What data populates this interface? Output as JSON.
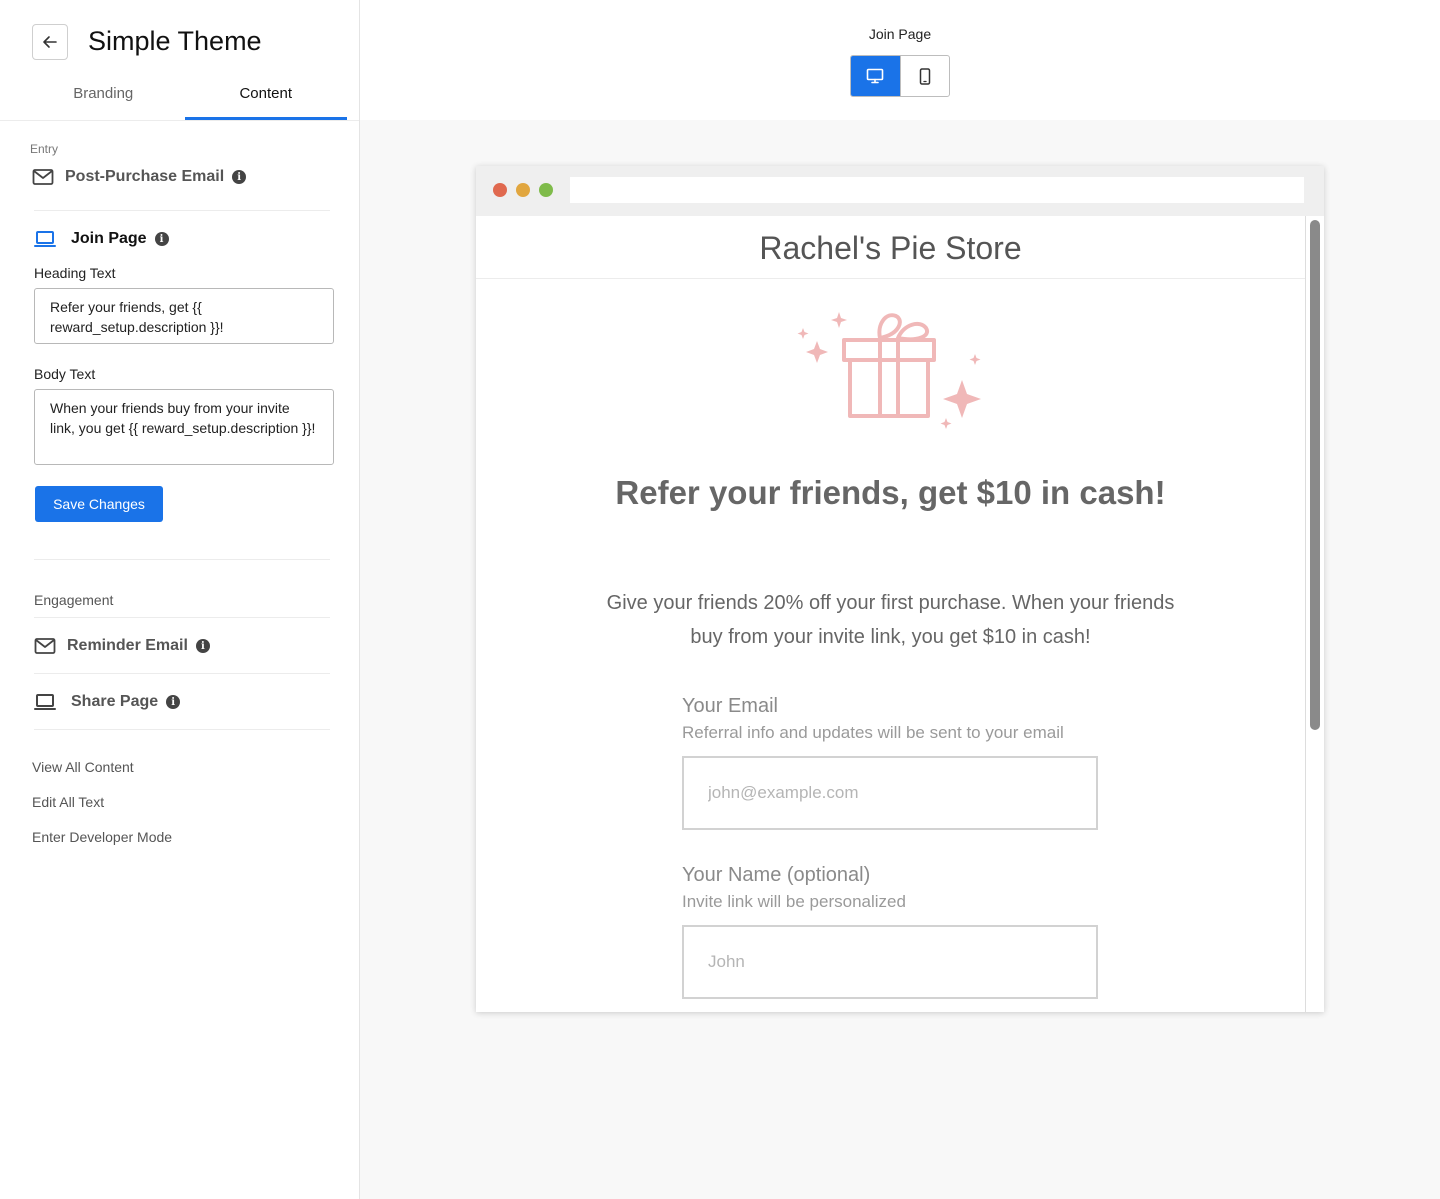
{
  "sidebar": {
    "title": "Simple Theme",
    "tabs": [
      {
        "label": "Branding",
        "active": false
      },
      {
        "label": "Content",
        "active": true
      }
    ],
    "entry_label": "Entry",
    "post_purchase_email": "Post-Purchase Email",
    "join_page": "Join Page",
    "heading_text_label": "Heading Text",
    "heading_text_value": "Refer your friends, get {{ reward_setup.description }}!",
    "body_text_label": "Body Text",
    "body_text_value": "When your friends buy from your invite link, you get {{ reward_setup.description }}!",
    "save_label": "Save Changes",
    "engagement_label": "Engagement",
    "reminder_email": "Reminder Email",
    "share_page": "Share Page",
    "links": [
      "View All Content",
      "Edit All Text",
      "Enter Developer Mode"
    ],
    "info_glyph": "i"
  },
  "header": {
    "page_name": "Join Page",
    "views": [
      {
        "name": "desktop-icon",
        "active": true
      },
      {
        "name": "mobile-icon",
        "active": false
      }
    ]
  },
  "preview": {
    "window_dots": [
      "#e0694f",
      "#e1a63f",
      "#7fbb4a"
    ],
    "store_name": "Rachel's Pie Store",
    "gift_color": "#f0b8b8",
    "hero": "Refer your friends, get $10 in cash!",
    "subtext": "Give your friends 20% off your first purchase. When your friends buy from your invite link, you get $10 in cash!",
    "email_label": "Your Email",
    "email_help": "Referral info and updates will be sent to your email",
    "email_placeholder": "john@example.com",
    "name_label": "Your Name (optional)",
    "name_help": "Invite link will be personalized",
    "name_placeholder": "John"
  },
  "colors": {
    "accent": "#1a73e8"
  }
}
